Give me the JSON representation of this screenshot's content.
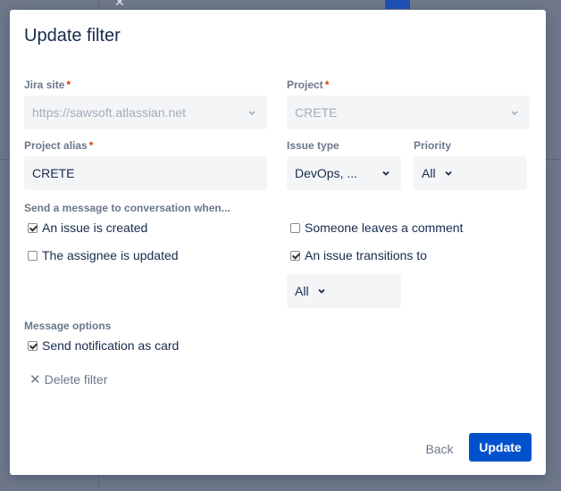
{
  "dialog": {
    "title": "Update filter"
  },
  "jira_site": {
    "label": "Jira site",
    "required_mark": "*",
    "value": "https://sawsoft.atlassian.net"
  },
  "project": {
    "label": "Project",
    "required_mark": "*",
    "value": "CRETE"
  },
  "project_alias": {
    "label": "Project alias",
    "required_mark": "*",
    "value": "CRETE"
  },
  "issue_type": {
    "label": "Issue type",
    "value": "DevOps, ..."
  },
  "priority": {
    "label": "Priority",
    "value": "All"
  },
  "conversation": {
    "heading": "Send a message to conversation when...",
    "options": [
      {
        "label": "An issue is created",
        "checked": true
      },
      {
        "label": "The assignee is updated",
        "checked": false
      },
      {
        "label": "Someone leaves a comment",
        "checked": false
      },
      {
        "label": "An issue transitions to",
        "checked": true
      }
    ],
    "transition_value": "All"
  },
  "message_options": {
    "heading": "Message options",
    "card": {
      "label": "Send notification as card",
      "checked": true
    }
  },
  "actions": {
    "delete_label": "Delete filter",
    "back_label": "Back",
    "update_label": "Update"
  },
  "colors": {
    "primary": "#0052cc",
    "label": "#6b778c",
    "text": "#172b4d",
    "required": "#de350b"
  }
}
